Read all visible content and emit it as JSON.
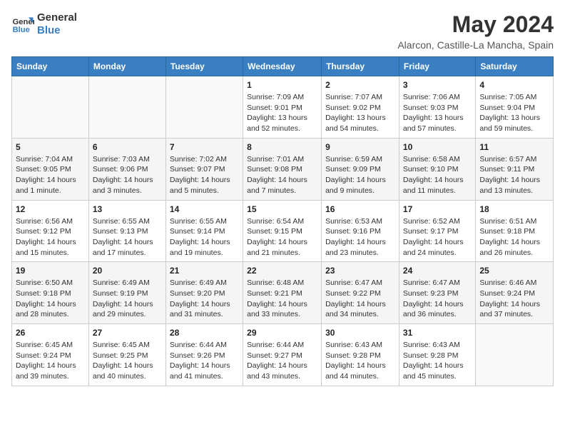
{
  "logo": {
    "line1": "General",
    "line2": "Blue"
  },
  "title": "May 2024",
  "location": "Alarcon, Castille-La Mancha, Spain",
  "days_of_week": [
    "Sunday",
    "Monday",
    "Tuesday",
    "Wednesday",
    "Thursday",
    "Friday",
    "Saturday"
  ],
  "weeks": [
    [
      {
        "day": "",
        "info": ""
      },
      {
        "day": "",
        "info": ""
      },
      {
        "day": "",
        "info": ""
      },
      {
        "day": "1",
        "info": "Sunrise: 7:09 AM\nSunset: 9:01 PM\nDaylight: 13 hours and 52 minutes."
      },
      {
        "day": "2",
        "info": "Sunrise: 7:07 AM\nSunset: 9:02 PM\nDaylight: 13 hours and 54 minutes."
      },
      {
        "day": "3",
        "info": "Sunrise: 7:06 AM\nSunset: 9:03 PM\nDaylight: 13 hours and 57 minutes."
      },
      {
        "day": "4",
        "info": "Sunrise: 7:05 AM\nSunset: 9:04 PM\nDaylight: 13 hours and 59 minutes."
      }
    ],
    [
      {
        "day": "5",
        "info": "Sunrise: 7:04 AM\nSunset: 9:05 PM\nDaylight: 14 hours and 1 minute."
      },
      {
        "day": "6",
        "info": "Sunrise: 7:03 AM\nSunset: 9:06 PM\nDaylight: 14 hours and 3 minutes."
      },
      {
        "day": "7",
        "info": "Sunrise: 7:02 AM\nSunset: 9:07 PM\nDaylight: 14 hours and 5 minutes."
      },
      {
        "day": "8",
        "info": "Sunrise: 7:01 AM\nSunset: 9:08 PM\nDaylight: 14 hours and 7 minutes."
      },
      {
        "day": "9",
        "info": "Sunrise: 6:59 AM\nSunset: 9:09 PM\nDaylight: 14 hours and 9 minutes."
      },
      {
        "day": "10",
        "info": "Sunrise: 6:58 AM\nSunset: 9:10 PM\nDaylight: 14 hours and 11 minutes."
      },
      {
        "day": "11",
        "info": "Sunrise: 6:57 AM\nSunset: 9:11 PM\nDaylight: 14 hours and 13 minutes."
      }
    ],
    [
      {
        "day": "12",
        "info": "Sunrise: 6:56 AM\nSunset: 9:12 PM\nDaylight: 14 hours and 15 minutes."
      },
      {
        "day": "13",
        "info": "Sunrise: 6:55 AM\nSunset: 9:13 PM\nDaylight: 14 hours and 17 minutes."
      },
      {
        "day": "14",
        "info": "Sunrise: 6:55 AM\nSunset: 9:14 PM\nDaylight: 14 hours and 19 minutes."
      },
      {
        "day": "15",
        "info": "Sunrise: 6:54 AM\nSunset: 9:15 PM\nDaylight: 14 hours and 21 minutes."
      },
      {
        "day": "16",
        "info": "Sunrise: 6:53 AM\nSunset: 9:16 PM\nDaylight: 14 hours and 23 minutes."
      },
      {
        "day": "17",
        "info": "Sunrise: 6:52 AM\nSunset: 9:17 PM\nDaylight: 14 hours and 24 minutes."
      },
      {
        "day": "18",
        "info": "Sunrise: 6:51 AM\nSunset: 9:18 PM\nDaylight: 14 hours and 26 minutes."
      }
    ],
    [
      {
        "day": "19",
        "info": "Sunrise: 6:50 AM\nSunset: 9:18 PM\nDaylight: 14 hours and 28 minutes."
      },
      {
        "day": "20",
        "info": "Sunrise: 6:49 AM\nSunset: 9:19 PM\nDaylight: 14 hours and 29 minutes."
      },
      {
        "day": "21",
        "info": "Sunrise: 6:49 AM\nSunset: 9:20 PM\nDaylight: 14 hours and 31 minutes."
      },
      {
        "day": "22",
        "info": "Sunrise: 6:48 AM\nSunset: 9:21 PM\nDaylight: 14 hours and 33 minutes."
      },
      {
        "day": "23",
        "info": "Sunrise: 6:47 AM\nSunset: 9:22 PM\nDaylight: 14 hours and 34 minutes."
      },
      {
        "day": "24",
        "info": "Sunrise: 6:47 AM\nSunset: 9:23 PM\nDaylight: 14 hours and 36 minutes."
      },
      {
        "day": "25",
        "info": "Sunrise: 6:46 AM\nSunset: 9:24 PM\nDaylight: 14 hours and 37 minutes."
      }
    ],
    [
      {
        "day": "26",
        "info": "Sunrise: 6:45 AM\nSunset: 9:24 PM\nDaylight: 14 hours and 39 minutes."
      },
      {
        "day": "27",
        "info": "Sunrise: 6:45 AM\nSunset: 9:25 PM\nDaylight: 14 hours and 40 minutes."
      },
      {
        "day": "28",
        "info": "Sunrise: 6:44 AM\nSunset: 9:26 PM\nDaylight: 14 hours and 41 minutes."
      },
      {
        "day": "29",
        "info": "Sunrise: 6:44 AM\nSunset: 9:27 PM\nDaylight: 14 hours and 43 minutes."
      },
      {
        "day": "30",
        "info": "Sunrise: 6:43 AM\nSunset: 9:28 PM\nDaylight: 14 hours and 44 minutes."
      },
      {
        "day": "31",
        "info": "Sunrise: 6:43 AM\nSunset: 9:28 PM\nDaylight: 14 hours and 45 minutes."
      },
      {
        "day": "",
        "info": ""
      }
    ]
  ]
}
